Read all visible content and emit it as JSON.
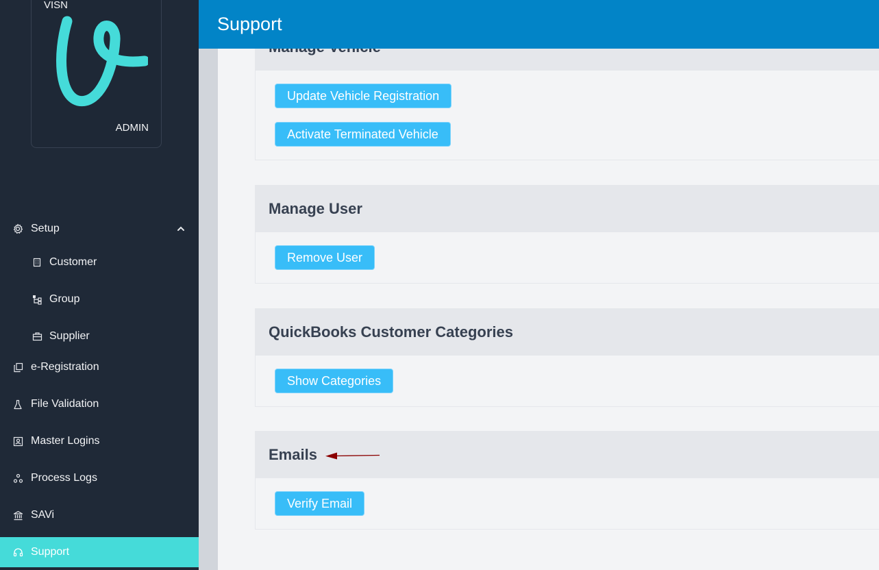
{
  "sidebar": {
    "logo": {
      "top_text": "VISN",
      "bottom_text": "ADMIN"
    },
    "items": [
      {
        "label": "Setup",
        "icon": "gear-icon",
        "expanded": true
      },
      {
        "label": "Customer",
        "icon": "building-icon",
        "sub": true
      },
      {
        "label": "Group",
        "icon": "hierarchy-icon",
        "sub": true
      },
      {
        "label": "Supplier",
        "icon": "briefcase-icon",
        "sub": true
      },
      {
        "label": "e-Registration",
        "icon": "copy-icon"
      },
      {
        "label": "File Validation",
        "icon": "flask-icon"
      },
      {
        "label": "Master Logins",
        "icon": "id-card-icon"
      },
      {
        "label": "Process Logs",
        "icon": "nodes-icon"
      },
      {
        "label": "SAVi",
        "icon": "bank-icon"
      },
      {
        "label": "Support",
        "icon": "headset-icon",
        "active": true
      }
    ]
  },
  "header": {
    "title": "Support"
  },
  "sections": [
    {
      "title": "Manage Vehicle",
      "buttons": [
        "Update Vehicle Registration",
        "Activate Terminated Vehicle"
      ]
    },
    {
      "title": "Manage User",
      "buttons": [
        "Remove User"
      ]
    },
    {
      "title": "QuickBooks Customer Categories",
      "buttons": [
        "Show Categories"
      ]
    },
    {
      "title": "Emails",
      "buttons": [
        "Verify Email"
      ]
    }
  ],
  "colors": {
    "sidebar": "#1f2937",
    "active": "#45dbd9",
    "header": "#0284c7",
    "button": "#38bdf8",
    "arrow": "#8b0000"
  }
}
